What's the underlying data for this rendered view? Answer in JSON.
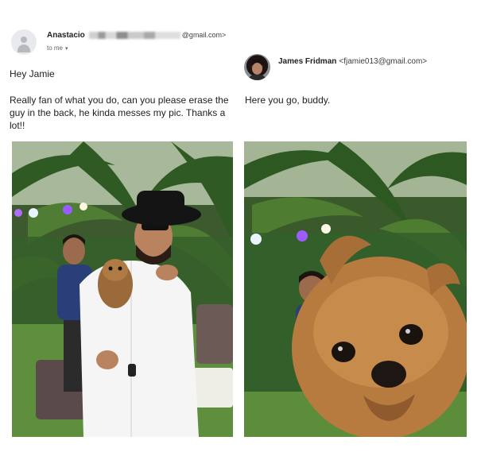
{
  "request_email": {
    "sender_name": "Anastacio",
    "sender_email_visible": "@gmail.com>",
    "to_label": "to me",
    "greeting": "Hey Jamie",
    "message": "Really fan of what you do, can you please erase the guy in the back, he kinda messes my pic. Thanks a lot!!"
  },
  "reply_email": {
    "sender_name": "James Fridman",
    "sender_email": "<fjamie013@gmail.com>",
    "message": "Here you go, buddy."
  },
  "icons": {
    "caret": "chevron-down-icon",
    "sender_avatar": "default-avatar-icon",
    "reply_avatar": "profile-photo"
  }
}
